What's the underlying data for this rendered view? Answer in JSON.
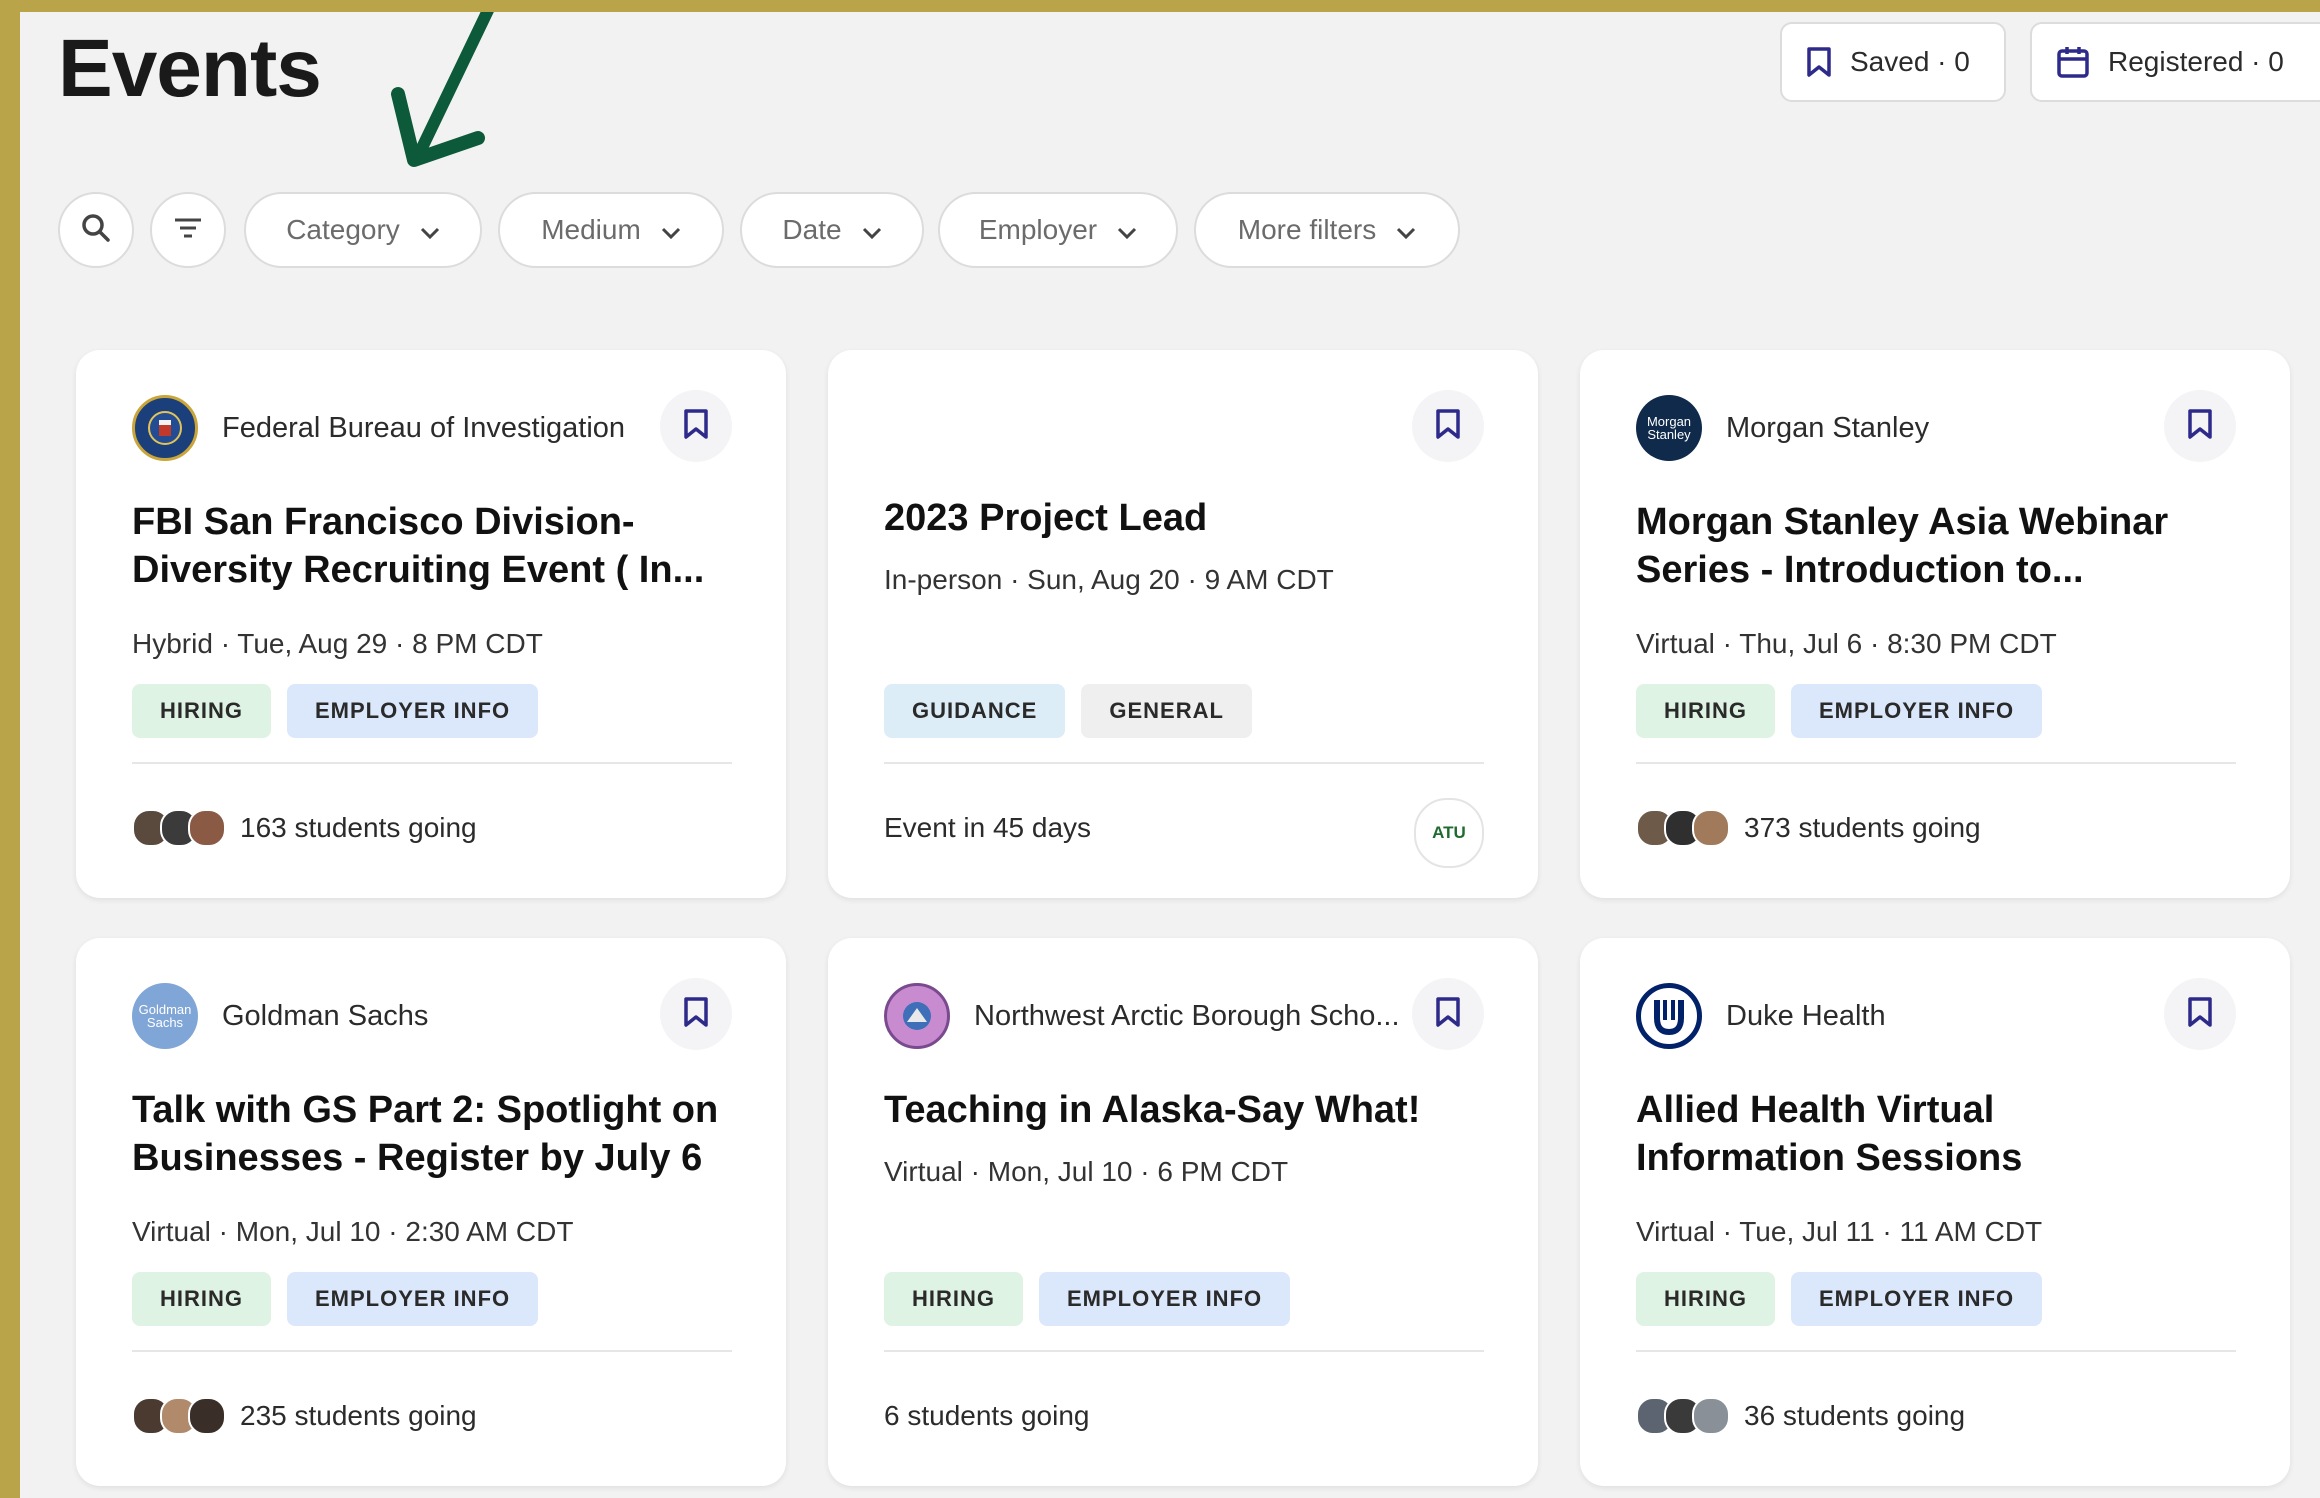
{
  "header": {
    "title": "Events",
    "saved_label": "Saved · 0",
    "registered_label": "Registered · 0"
  },
  "filters": {
    "category": "Category",
    "medium": "Medium",
    "date": "Date",
    "employer": "Employer",
    "more": "More filters"
  },
  "events": [
    {
      "org": "Federal Bureau of Investigation",
      "title_line1": "FBI San Francisco Division-",
      "title_line2": "Diversity Recruiting Event ( In...",
      "meta": "Hybrid · Tue, Aug 29 · 8 PM CDT",
      "tag1": "HIRING",
      "tag2": "EMPLOYER INFO",
      "footer": "163 students going"
    },
    {
      "org": "",
      "title_line1": "2023 Project Lead",
      "meta": "In-person · Sun, Aug 20 · 9 AM CDT",
      "tag1": "GUIDANCE",
      "tag2": "GENERAL",
      "footer": "Event in 45 days",
      "logo_text": "ATU"
    },
    {
      "org": "Morgan Stanley",
      "logo_text": "Morgan Stanley",
      "title_line1": "Morgan Stanley Asia Webinar",
      "title_line2": "Series - Introduction to...",
      "meta": "Virtual · Thu, Jul 6 · 8:30 PM CDT",
      "tag1": "HIRING",
      "tag2": "EMPLOYER INFO",
      "footer": "373 students going"
    },
    {
      "org": "Goldman Sachs",
      "logo_text": "Goldman Sachs",
      "title_line1": "Talk with GS Part 2: Spotlight on",
      "title_line2": "Businesses - Register by July 6",
      "meta": "Virtual · Mon, Jul 10 · 2:30 AM CDT",
      "tag1": "HIRING",
      "tag2": "EMPLOYER INFO",
      "footer": "235 students going"
    },
    {
      "org": "Northwest Arctic Borough Scho...",
      "title_line1": "Teaching in Alaska-Say What!",
      "meta": "Virtual · Mon, Jul 10 · 6 PM CDT",
      "tag1": "HIRING",
      "tag2": "EMPLOYER INFO",
      "footer": "6 students going"
    },
    {
      "org": "Duke Health",
      "title_line1": "Allied Health Virtual",
      "title_line2": "Information Sessions",
      "meta": "Virtual · Tue, Jul 11 · 11 AM CDT",
      "tag1": "HIRING",
      "tag2": "EMPLOYER INFO",
      "footer": "36 students going"
    }
  ],
  "colors": {
    "accent": "#2d2a8a",
    "hiring_tag": "#dff3e4",
    "employer_tag": "#dbe8fb",
    "guidance_tag": "#dcedf7",
    "general_tag": "#efefef",
    "arrow": "#0d5a3a",
    "frame": "#b9a44a"
  }
}
